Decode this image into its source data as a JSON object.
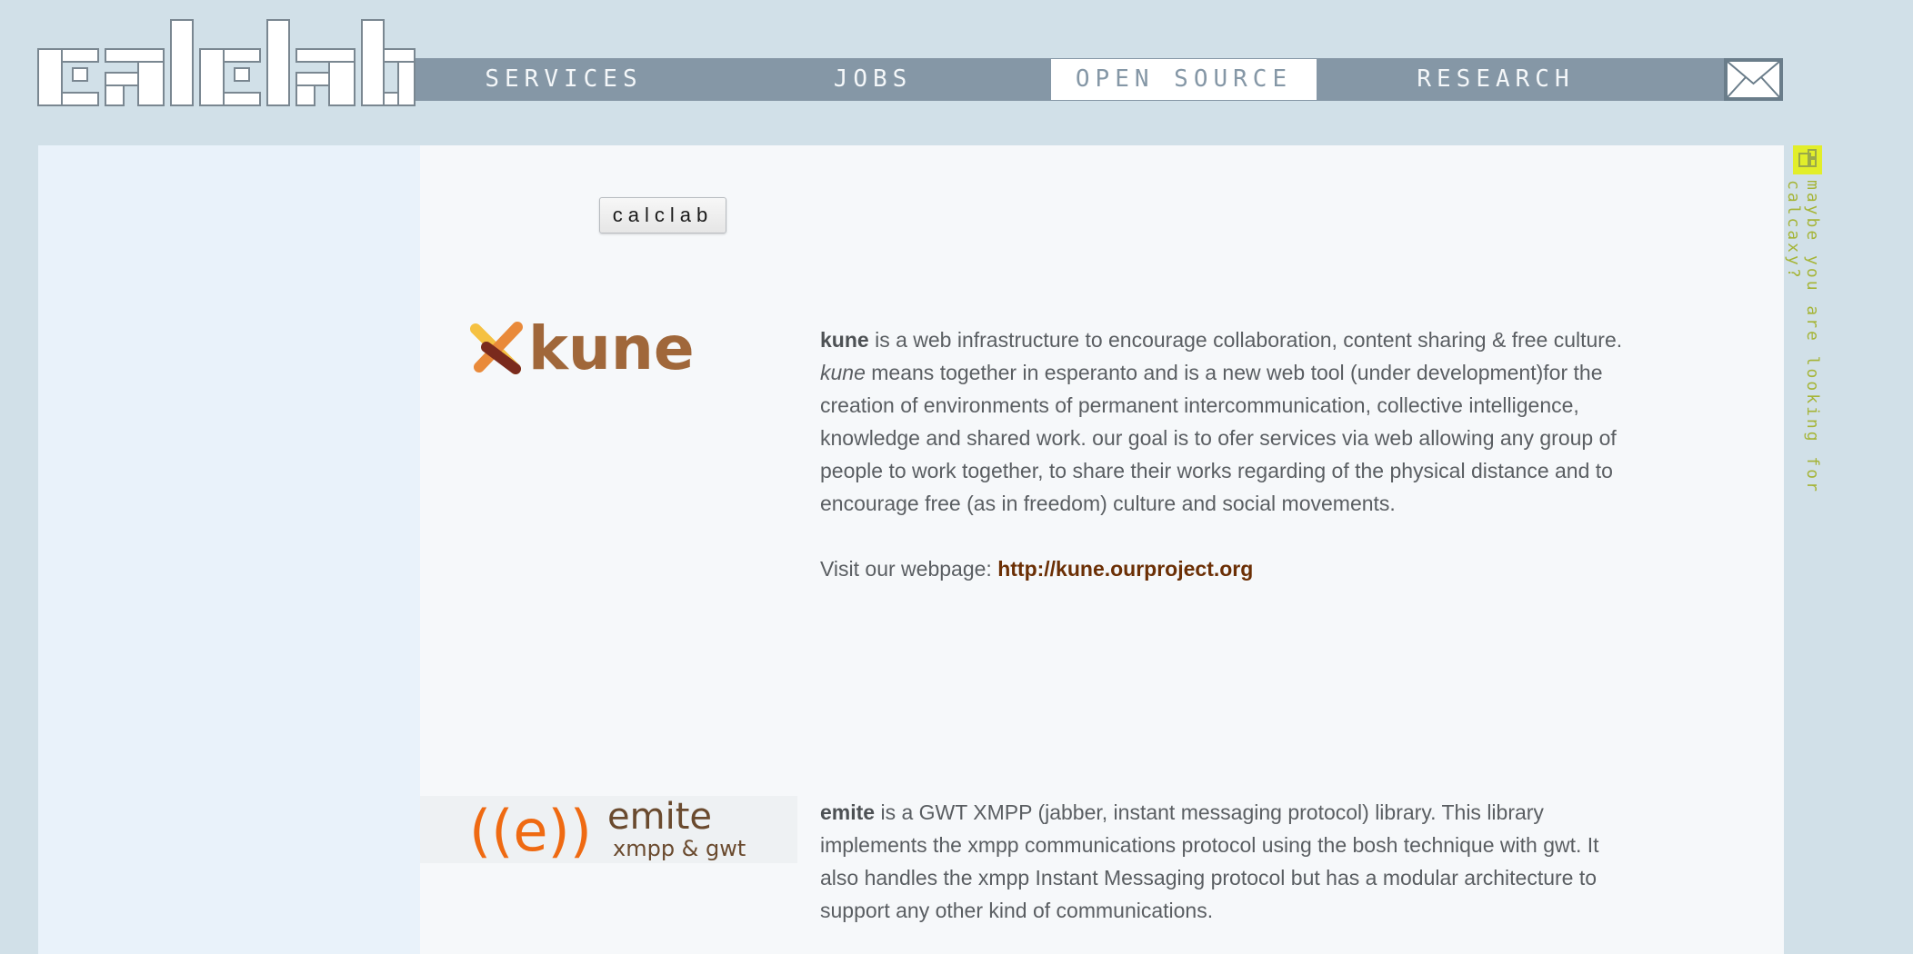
{
  "logo": {
    "text": "calclab"
  },
  "nav": {
    "items": [
      {
        "label": "SERVICES"
      },
      {
        "label": "JOBS"
      },
      {
        "label": "OPEN SOURCE",
        "active": true
      },
      {
        "label": "RESEARCH"
      }
    ],
    "mail_icon": "envelope-icon"
  },
  "main": {
    "tag_button": "calclab",
    "projects": [
      {
        "name": "kune",
        "logo_text": "kune",
        "lead": " is a web infrastructure to encourage collaboration, content sharing & free culture.",
        "italic_name": "kune",
        "description": " means together in esperanto and is a new web tool (under development)for the creation of environments of permanent intercommunication, collective intelligence, knowledge and shared work. our goal is to ofer services via web allowing any group of people to work together, to share their works regarding of the physical distance and to encourage free (as in freedom) culture and social movements.",
        "visit_label": "Visit our webpage: ",
        "url": "http://kune.ourproject.org"
      },
      {
        "name": "emite",
        "logo_text": "emite",
        "logo_subtext": "xmpp & gwt",
        "logo_mark": "((e))",
        "lead": " is a GWT XMPP (jabber, instant messaging protocol) library. This library implements the xmpp communications protocol using the bosh technique with gwt. It also handles the xmpp Instant Messaging protocol but has a modular architecture to support any other kind of communications."
      }
    ]
  },
  "side_hint": {
    "icon": "calcaxy-icon",
    "text": "maybe you are looking for calcaxy?"
  },
  "colors": {
    "background": "#d1e0e8",
    "navbar": "#8597a6",
    "link": "#6b2f05",
    "hint": "#a5b437",
    "hint_icon": "#e2ee2a"
  }
}
